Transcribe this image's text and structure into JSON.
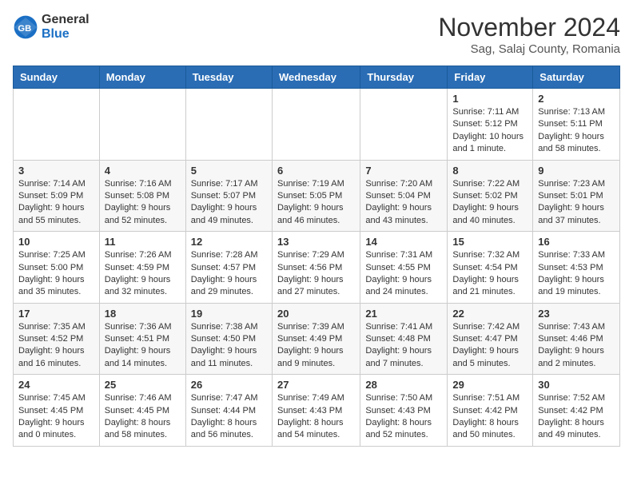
{
  "logo": {
    "general": "General",
    "blue": "Blue"
  },
  "header": {
    "title": "November 2024",
    "subtitle": "Sag, Salaj County, Romania"
  },
  "weekdays": [
    "Sunday",
    "Monday",
    "Tuesday",
    "Wednesday",
    "Thursday",
    "Friday",
    "Saturday"
  ],
  "weeks": [
    [
      {
        "day": "",
        "info": ""
      },
      {
        "day": "",
        "info": ""
      },
      {
        "day": "",
        "info": ""
      },
      {
        "day": "",
        "info": ""
      },
      {
        "day": "",
        "info": ""
      },
      {
        "day": "1",
        "info": "Sunrise: 7:11 AM\nSunset: 5:12 PM\nDaylight: 10 hours and 1 minute."
      },
      {
        "day": "2",
        "info": "Sunrise: 7:13 AM\nSunset: 5:11 PM\nDaylight: 9 hours and 58 minutes."
      }
    ],
    [
      {
        "day": "3",
        "info": "Sunrise: 7:14 AM\nSunset: 5:09 PM\nDaylight: 9 hours and 55 minutes."
      },
      {
        "day": "4",
        "info": "Sunrise: 7:16 AM\nSunset: 5:08 PM\nDaylight: 9 hours and 52 minutes."
      },
      {
        "day": "5",
        "info": "Sunrise: 7:17 AM\nSunset: 5:07 PM\nDaylight: 9 hours and 49 minutes."
      },
      {
        "day": "6",
        "info": "Sunrise: 7:19 AM\nSunset: 5:05 PM\nDaylight: 9 hours and 46 minutes."
      },
      {
        "day": "7",
        "info": "Sunrise: 7:20 AM\nSunset: 5:04 PM\nDaylight: 9 hours and 43 minutes."
      },
      {
        "day": "8",
        "info": "Sunrise: 7:22 AM\nSunset: 5:02 PM\nDaylight: 9 hours and 40 minutes."
      },
      {
        "day": "9",
        "info": "Sunrise: 7:23 AM\nSunset: 5:01 PM\nDaylight: 9 hours and 37 minutes."
      }
    ],
    [
      {
        "day": "10",
        "info": "Sunrise: 7:25 AM\nSunset: 5:00 PM\nDaylight: 9 hours and 35 minutes."
      },
      {
        "day": "11",
        "info": "Sunrise: 7:26 AM\nSunset: 4:59 PM\nDaylight: 9 hours and 32 minutes."
      },
      {
        "day": "12",
        "info": "Sunrise: 7:28 AM\nSunset: 4:57 PM\nDaylight: 9 hours and 29 minutes."
      },
      {
        "day": "13",
        "info": "Sunrise: 7:29 AM\nSunset: 4:56 PM\nDaylight: 9 hours and 27 minutes."
      },
      {
        "day": "14",
        "info": "Sunrise: 7:31 AM\nSunset: 4:55 PM\nDaylight: 9 hours and 24 minutes."
      },
      {
        "day": "15",
        "info": "Sunrise: 7:32 AM\nSunset: 4:54 PM\nDaylight: 9 hours and 21 minutes."
      },
      {
        "day": "16",
        "info": "Sunrise: 7:33 AM\nSunset: 4:53 PM\nDaylight: 9 hours and 19 minutes."
      }
    ],
    [
      {
        "day": "17",
        "info": "Sunrise: 7:35 AM\nSunset: 4:52 PM\nDaylight: 9 hours and 16 minutes."
      },
      {
        "day": "18",
        "info": "Sunrise: 7:36 AM\nSunset: 4:51 PM\nDaylight: 9 hours and 14 minutes."
      },
      {
        "day": "19",
        "info": "Sunrise: 7:38 AM\nSunset: 4:50 PM\nDaylight: 9 hours and 11 minutes."
      },
      {
        "day": "20",
        "info": "Sunrise: 7:39 AM\nSunset: 4:49 PM\nDaylight: 9 hours and 9 minutes."
      },
      {
        "day": "21",
        "info": "Sunrise: 7:41 AM\nSunset: 4:48 PM\nDaylight: 9 hours and 7 minutes."
      },
      {
        "day": "22",
        "info": "Sunrise: 7:42 AM\nSunset: 4:47 PM\nDaylight: 9 hours and 5 minutes."
      },
      {
        "day": "23",
        "info": "Sunrise: 7:43 AM\nSunset: 4:46 PM\nDaylight: 9 hours and 2 minutes."
      }
    ],
    [
      {
        "day": "24",
        "info": "Sunrise: 7:45 AM\nSunset: 4:45 PM\nDaylight: 9 hours and 0 minutes."
      },
      {
        "day": "25",
        "info": "Sunrise: 7:46 AM\nSunset: 4:45 PM\nDaylight: 8 hours and 58 minutes."
      },
      {
        "day": "26",
        "info": "Sunrise: 7:47 AM\nSunset: 4:44 PM\nDaylight: 8 hours and 56 minutes."
      },
      {
        "day": "27",
        "info": "Sunrise: 7:49 AM\nSunset: 4:43 PM\nDaylight: 8 hours and 54 minutes."
      },
      {
        "day": "28",
        "info": "Sunrise: 7:50 AM\nSunset: 4:43 PM\nDaylight: 8 hours and 52 minutes."
      },
      {
        "day": "29",
        "info": "Sunrise: 7:51 AM\nSunset: 4:42 PM\nDaylight: 8 hours and 50 minutes."
      },
      {
        "day": "30",
        "info": "Sunrise: 7:52 AM\nSunset: 4:42 PM\nDaylight: 8 hours and 49 minutes."
      }
    ]
  ]
}
